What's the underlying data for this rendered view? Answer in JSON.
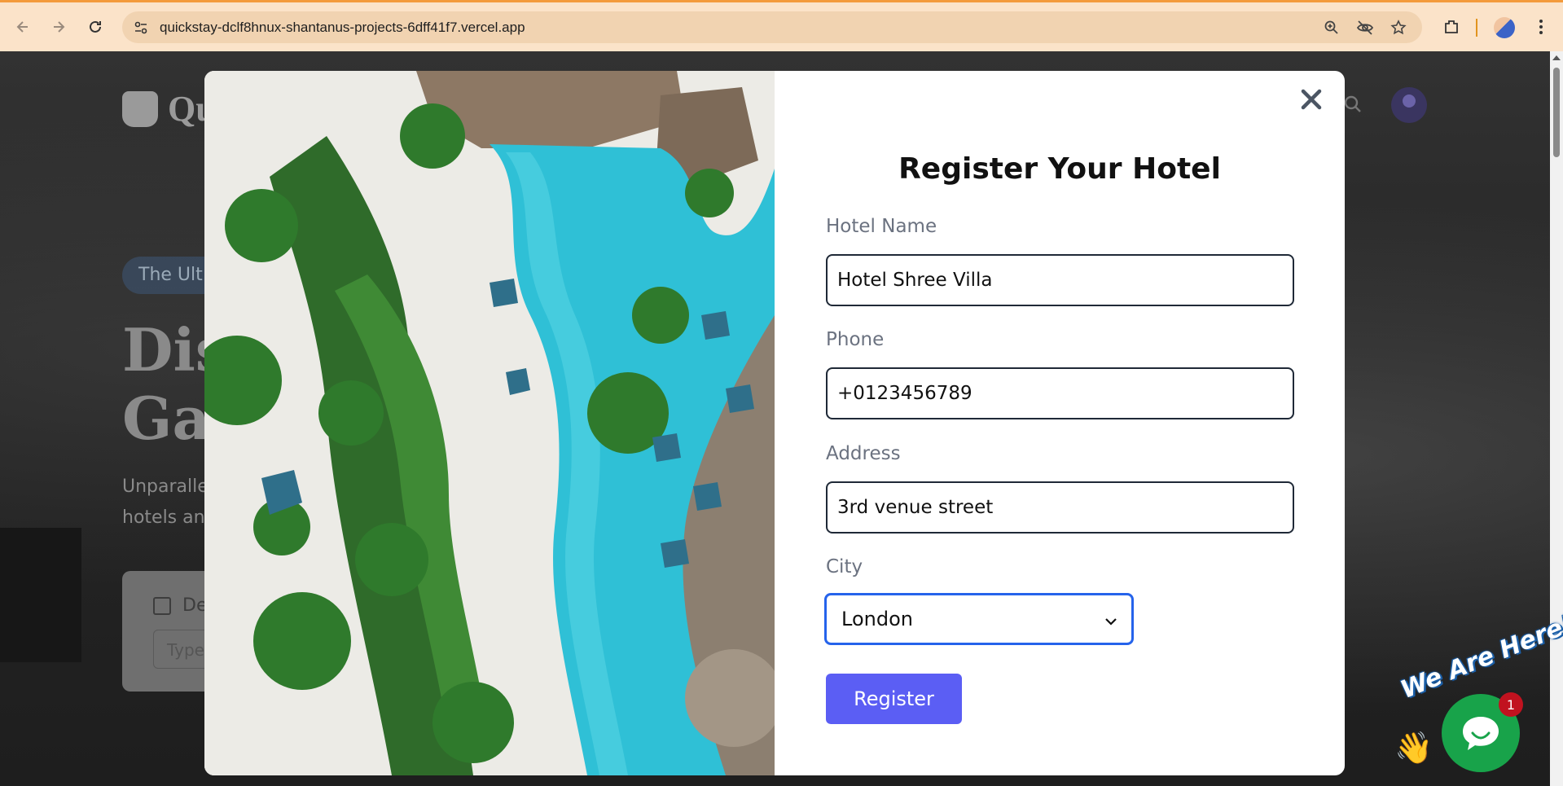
{
  "browser": {
    "url": "quickstay-dclf8hnux-shantanus-projects-6dff41f7.vercel.app",
    "icons": [
      "back-icon",
      "forward-icon",
      "reload-icon",
      "site-info-icon",
      "zoom-icon",
      "eye-off-icon",
      "star-icon",
      "extensions-icon",
      "kebab-menu-icon"
    ]
  },
  "background_page": {
    "logo_text": "Qu",
    "pill_text": "The Ult",
    "headline_line1": "Dis",
    "headline_line2": "Ga",
    "sub_line1": "Unparalle",
    "sub_line2": "hotels an",
    "card_label": "De",
    "card_input_placeholder": "Type"
  },
  "modal": {
    "title": "Register Your Hotel",
    "fields": {
      "hotel_name": {
        "label": "Hotel Name",
        "value": "Hotel Shree Villa"
      },
      "phone": {
        "label": "Phone",
        "value": "+0123456789"
      },
      "address": {
        "label": "Address",
        "value": "3rd venue street"
      },
      "city": {
        "label": "City",
        "value": "London"
      }
    },
    "register_label": "Register",
    "close_icon": "close-icon",
    "image_description": "aerial-resort-pool"
  },
  "chat_widget": {
    "banner_text": "We Are Here!",
    "badge_count": "1",
    "wave": "👋"
  },
  "colors": {
    "accent": "#5b5ef4",
    "select_focus": "#2563eb",
    "chat_green": "#18a34a",
    "badge_red": "#c1121f",
    "chrome_bg": "#fbe3c9"
  }
}
